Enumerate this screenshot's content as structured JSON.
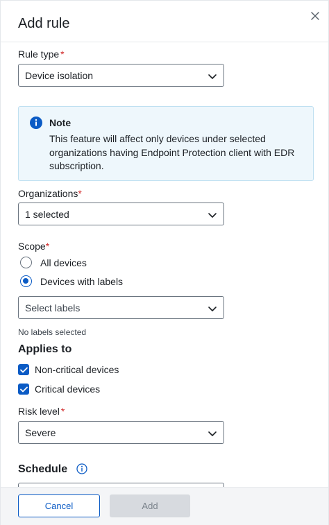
{
  "dialog": {
    "title": "Add rule"
  },
  "rule_type": {
    "label": "Rule type",
    "required_mark": "*",
    "value": "Device isolation"
  },
  "note": {
    "title": "Note",
    "text": "This feature will affect only devices under selected organizations having Endpoint Protection client with EDR subscription."
  },
  "organizations": {
    "label": "Organizations",
    "required_mark": "*",
    "value": "1 selected"
  },
  "scope": {
    "label": "Scope",
    "required_mark": "*",
    "options": [
      {
        "label": "All devices",
        "selected": false
      },
      {
        "label": "Devices with labels",
        "selected": true
      }
    ],
    "labels_placeholder": "Select labels",
    "labels_hint": "No labels selected"
  },
  "applies_to": {
    "title": "Applies to",
    "options": [
      {
        "label": "Non-critical devices",
        "checked": true
      },
      {
        "label": "Critical devices",
        "checked": true
      }
    ]
  },
  "risk_level": {
    "label": "Risk level",
    "required_mark": "*",
    "value": "Severe"
  },
  "schedule": {
    "title": "Schedule"
  },
  "footer": {
    "cancel_label": "Cancel",
    "add_label": "Add"
  },
  "colors": {
    "accent": "#0b5bc5",
    "required": "#d12b2b",
    "note_bg": "#eef7fc",
    "footer_bg": "#f4f5f7"
  },
  "icons": {
    "close": "close-icon",
    "chevron": "chevron-down-icon",
    "note": "info-icon",
    "schedule_info": "info-icon",
    "checkbox": "checkmark-icon"
  }
}
